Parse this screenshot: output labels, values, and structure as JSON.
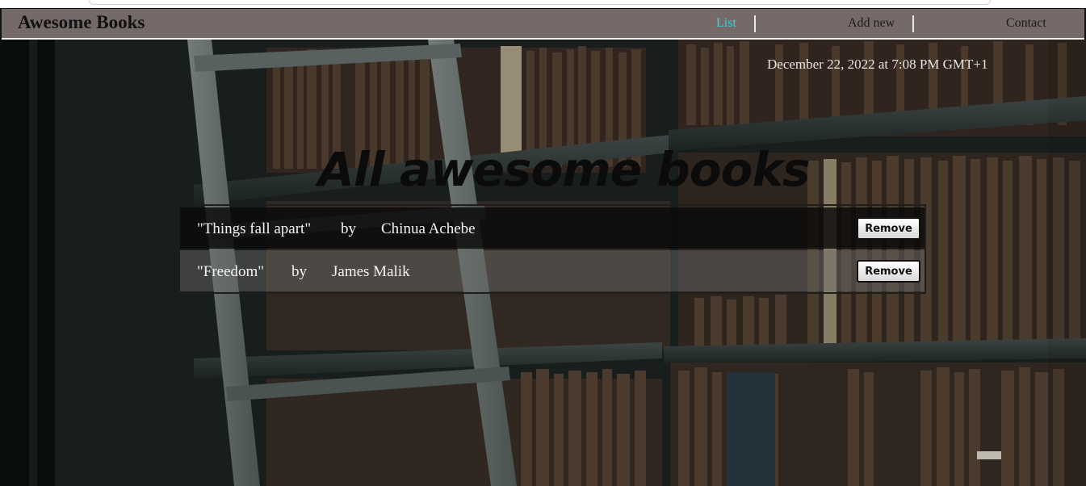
{
  "app": {
    "brand": "Awesome Books"
  },
  "nav": {
    "items": [
      {
        "label": "List",
        "active": true
      },
      {
        "label": "Add new",
        "active": false
      },
      {
        "label": "Contact",
        "active": false
      }
    ]
  },
  "datetime": "December 22, 2022 at 7:08 PM GMT+1",
  "main": {
    "title": "All awesome books"
  },
  "books": [
    {
      "title": "\"Things fall apart\"",
      "by": "by",
      "author": "Chinua Achebe",
      "remove_label": "Remove"
    },
    {
      "title": "\"Freedom\"",
      "by": "by",
      "author": "James Malik",
      "remove_label": "Remove"
    }
  ],
  "colors": {
    "navbar": "#766a68",
    "active_link": "#2fd8de",
    "text_light": "#f3f3f3"
  }
}
